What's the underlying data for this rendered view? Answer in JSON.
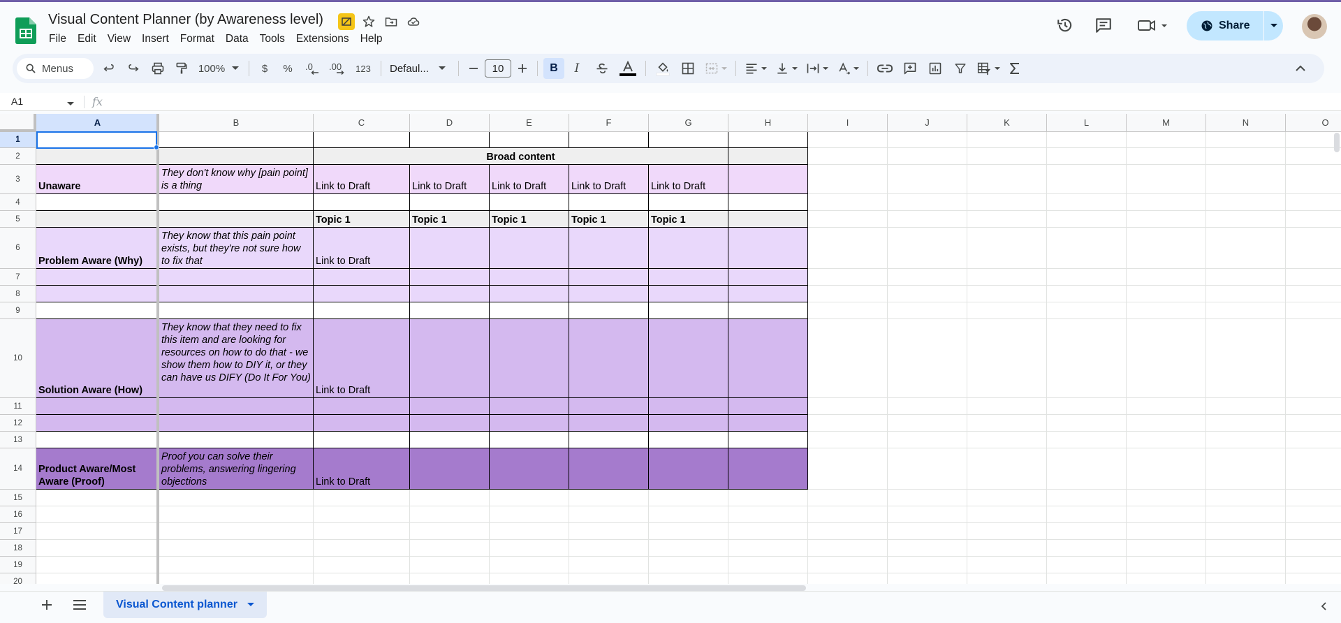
{
  "app": {
    "title": "Visual Content Planner (by Awareness level)",
    "menu": [
      "File",
      "Edit",
      "View",
      "Insert",
      "Format",
      "Data",
      "Tools",
      "Extensions",
      "Help"
    ],
    "share_label": "Share"
  },
  "toolbar": {
    "search_label": "Menus",
    "zoom": "100%",
    "currency": "$",
    "percent": "%",
    "dec_less": ".0",
    "dec_more": ".00",
    "number_format": "123",
    "font": "Defaul...",
    "font_size": "10",
    "bold": "B",
    "italic": "I"
  },
  "formula_bar": {
    "cell_ref": "A1",
    "fx": "fx"
  },
  "columns": [
    "A",
    "B",
    "C",
    "D",
    "E",
    "F",
    "G",
    "H",
    "I",
    "J",
    "K",
    "L",
    "M",
    "N",
    "O"
  ],
  "rows": [
    "1",
    "2",
    "3",
    "4",
    "5",
    "6",
    "7",
    "8",
    "9",
    "10",
    "11",
    "12",
    "13",
    "14",
    "15",
    "16",
    "17",
    "18",
    "19",
    "20"
  ],
  "cells": {
    "broad_content": "Broad content",
    "unaware": "Unaware",
    "unaware_desc": "They don't know why [pain point] is a thing",
    "link_to_draft": "Link to Draft",
    "topic_1": "Topic 1",
    "problem_aware": "Problem Aware (Why)",
    "problem_aware_desc": "They know that this pain point exists, but they're not sure how to fix that",
    "solution_aware": "Solution Aware (How)",
    "solution_aware_desc": "They know that they need to fix this item and are looking for resources on how to do that - we show them how to DIY it, or they can have us DIFY  (Do It For You)",
    "product_aware": "Product Aware/Most Aware (Proof)",
    "product_aware_desc": "Proof you can solve their problems, answering lingering objections"
  },
  "sheet_tab": "Visual Content planner",
  "colors": {
    "row_unaware": "#f0d9fa",
    "row_problem": "#e9d8fb",
    "row_solution": "#d4b9ef",
    "row_product": "#a57bcd",
    "row_gray": "#efefef",
    "accent": "#0b57d0"
  }
}
